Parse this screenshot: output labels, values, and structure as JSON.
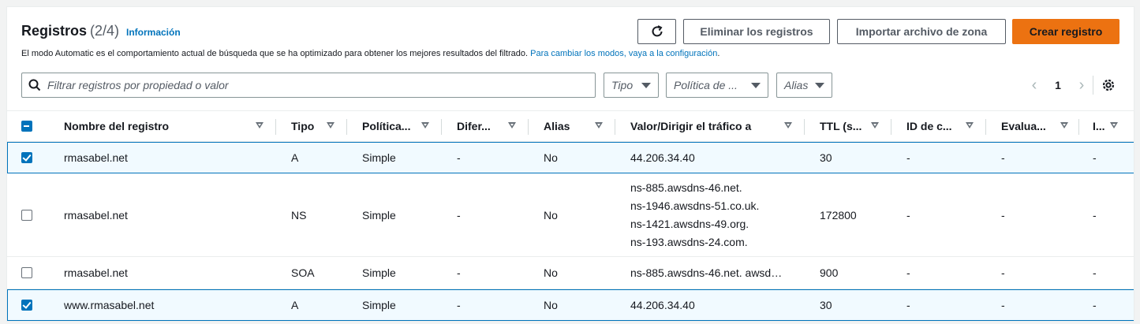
{
  "header": {
    "title": "Registros",
    "count": "(2/4)",
    "info_link": "Información",
    "description": "El modo Automatic es el comportamiento actual de búsqueda que se ha optimizado para obtener los mejores resultados del filtrado.",
    "description_link": "Para cambiar los modos, vaya a la configuración",
    "description_end": "."
  },
  "actions": {
    "refresh_icon": "refresh-icon",
    "delete_label": "Eliminar los registros",
    "import_label": "Importar archivo de zona",
    "create_label": "Crear registro"
  },
  "filters": {
    "search_placeholder": "Filtrar registros por propiedad o valor",
    "tipo": "Tipo",
    "politica": "Política de ...",
    "alias": "Alias"
  },
  "pagination": {
    "page": "1"
  },
  "columns": [
    "Nombre del registro",
    "Tipo",
    "Política...",
    "Difer...",
    "Alias",
    "Valor/Dirigir el tráfico a",
    "TTL (s...",
    "ID de c...",
    "Evalua...",
    "I..."
  ],
  "rows": [
    {
      "selected": true,
      "name": "rmasabel.net",
      "type": "A",
      "policy": "Simple",
      "diff": "-",
      "alias": "No",
      "value": [
        "44.206.34.40"
      ],
      "ttl": "30",
      "id": "-",
      "eval": "-",
      "i": "-"
    },
    {
      "selected": false,
      "name": "rmasabel.net",
      "type": "NS",
      "policy": "Simple",
      "diff": "-",
      "alias": "No",
      "value": [
        "ns-885.awsdns-46.net.",
        "ns-1946.awsdns-51.co.uk.",
        "ns-1421.awsdns-49.org.",
        "ns-193.awsdns-24.com."
      ],
      "ttl": "172800",
      "id": "-",
      "eval": "-",
      "i": "-"
    },
    {
      "selected": false,
      "name": "rmasabel.net",
      "type": "SOA",
      "policy": "Simple",
      "diff": "-",
      "alias": "No",
      "value": [
        "ns-885.awsdns-46.net. awsd…"
      ],
      "ttl": "900",
      "id": "-",
      "eval": "-",
      "i": "-"
    },
    {
      "selected": true,
      "name": "www.rmasabel.net",
      "type": "A",
      "policy": "Simple",
      "diff": "-",
      "alias": "No",
      "value": [
        "44.206.34.40"
      ],
      "ttl": "30",
      "id": "-",
      "eval": "-",
      "i": "-"
    }
  ],
  "colors": {
    "accent": "#0073bb",
    "primary_button": "#ec7211",
    "selected_row": "#f1faff"
  }
}
